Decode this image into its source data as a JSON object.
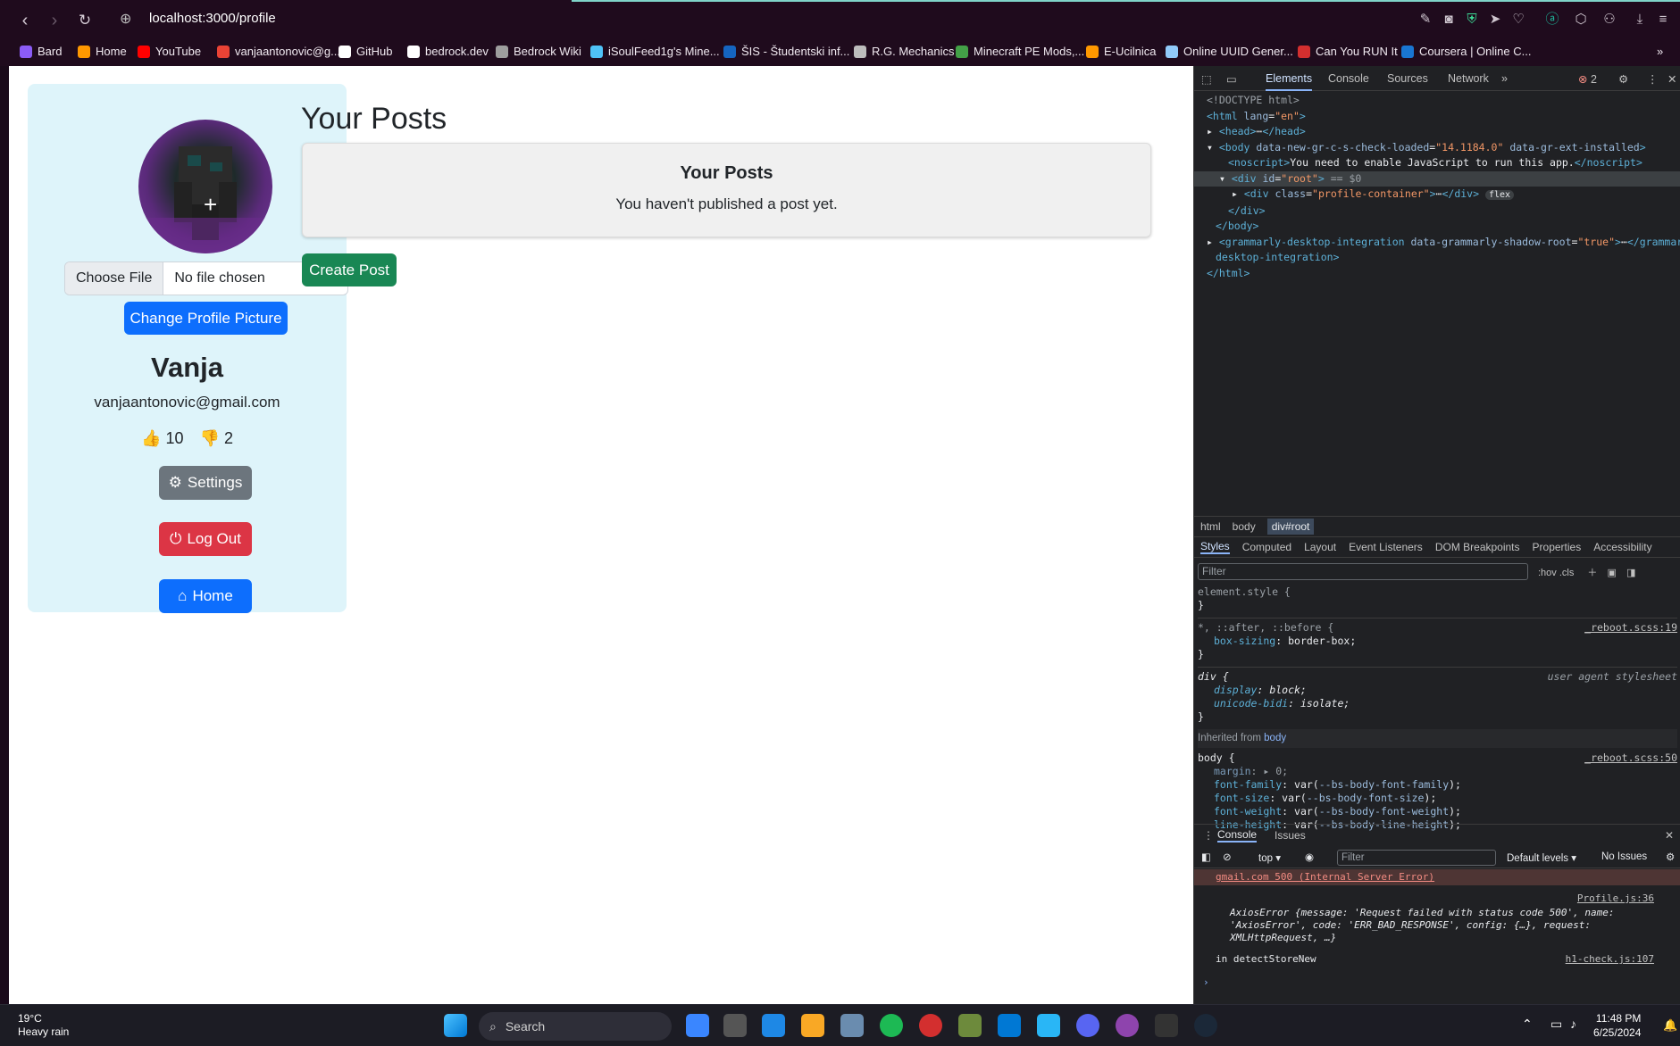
{
  "browser": {
    "url": "localhost:3000/profile",
    "bookmarks": [
      {
        "label": "Bard",
        "color": "#8b5cf6"
      },
      {
        "label": "Home",
        "color": "#ff9800"
      },
      {
        "label": "YouTube",
        "color": "#ff0000"
      },
      {
        "label": "vanjaantonovic@g...",
        "color": "#ea4335"
      },
      {
        "label": "GitHub",
        "color": "#ffffff"
      },
      {
        "label": "bedrock.dev",
        "color": "#ffffff"
      },
      {
        "label": "Bedrock Wiki",
        "color": "#9e9e9e"
      },
      {
        "label": "iSoulFeed1g's Mine...",
        "color": "#4fc3f7"
      },
      {
        "label": "ŠIS - Študentski inf...",
        "color": "#1565c0"
      },
      {
        "label": "R.G. Mechanics",
        "color": "#bdbdbd"
      },
      {
        "label": "Minecraft PE Mods,...",
        "color": "#43a047"
      },
      {
        "label": "E-Ucilnica",
        "color": "#ff9800"
      },
      {
        "label": "Online UUID Gener...",
        "color": "#90caf9"
      },
      {
        "label": "Can You RUN It",
        "color": "#d32f2f"
      },
      {
        "label": "Coursera | Online C...",
        "color": "#1976d2"
      }
    ]
  },
  "profile": {
    "file_button": "Choose File",
    "file_status": "No file chosen",
    "change_picture": "Change Profile Picture",
    "name": "Vanja",
    "email": "vanjaantonovic@gmail.com",
    "likes": "10",
    "dislikes": "2",
    "settings": "Settings",
    "logout": "Log Out",
    "home": "Home"
  },
  "posts": {
    "heading": "Your Posts",
    "box_title": "Your Posts",
    "empty": "You haven't published a post yet.",
    "create": "Create Post"
  },
  "devtools": {
    "tabs": [
      "Elements",
      "Console",
      "Sources",
      "Network"
    ],
    "error_count": "2",
    "breadcrumbs": [
      "html",
      "body",
      "div#root"
    ],
    "style_tabs": [
      "Styles",
      "Computed",
      "Layout",
      "Event Listeners",
      "DOM Breakpoints",
      "Properties",
      "Accessibility"
    ],
    "filter_placeholder": "Filter",
    "filter_tools": ":hov .cls",
    "console_tabs": [
      "Console",
      "Issues"
    ],
    "console_context": "top",
    "console_filter": "Filter",
    "console_levels": "Default levels",
    "console_issues": "No Issues",
    "log_error": "gmail.com 500 (Internal Server Error)",
    "log_src1": "Profile.js:36",
    "log_axios": "AxiosError {message: 'Request failed with status code 500', name: 'AxiosError', code: 'ERR_BAD_RESPONSE', config: {…}, request: XMLHttpRequest, …}",
    "log_detect": "in detectStoreNew",
    "log_src2": "h1-check.js:107"
  },
  "taskbar": {
    "temp": "19°C",
    "weather": "Heavy rain",
    "search": "Search",
    "time": "11:48 PM",
    "date": "6/25/2024"
  }
}
